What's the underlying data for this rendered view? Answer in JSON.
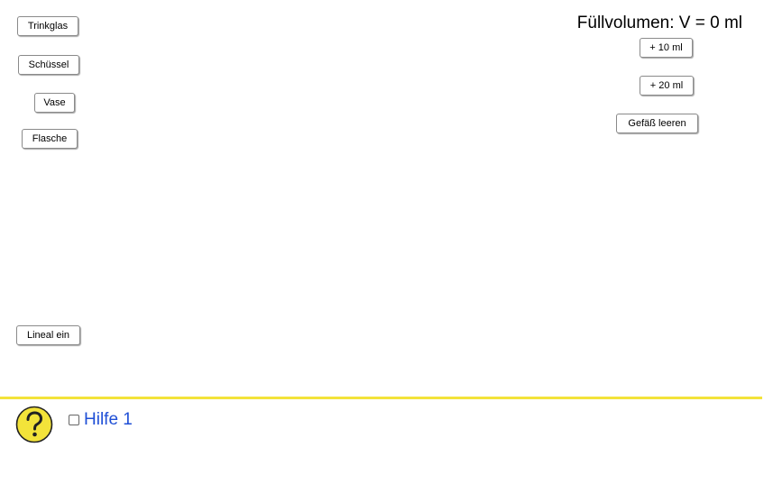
{
  "left_buttons": {
    "trinkglas": "Trinkglas",
    "schuessel": "Schüssel",
    "vase": "Vase",
    "flasche": "Flasche",
    "lineal": "Lineal ein"
  },
  "volume": {
    "label": "Füllvolumen: V = 0 ml"
  },
  "right_buttons": {
    "add10": "+ 10 ml",
    "add20": "+ 20 ml",
    "empty": "Gefäß leeren"
  },
  "help": {
    "icon": "question-icon",
    "label": "Hilfe 1",
    "checked": false
  },
  "colors": {
    "divider": "#f3e33a",
    "help_icon_fill": "#f3e33a",
    "help_label": "#1f4fd6"
  }
}
